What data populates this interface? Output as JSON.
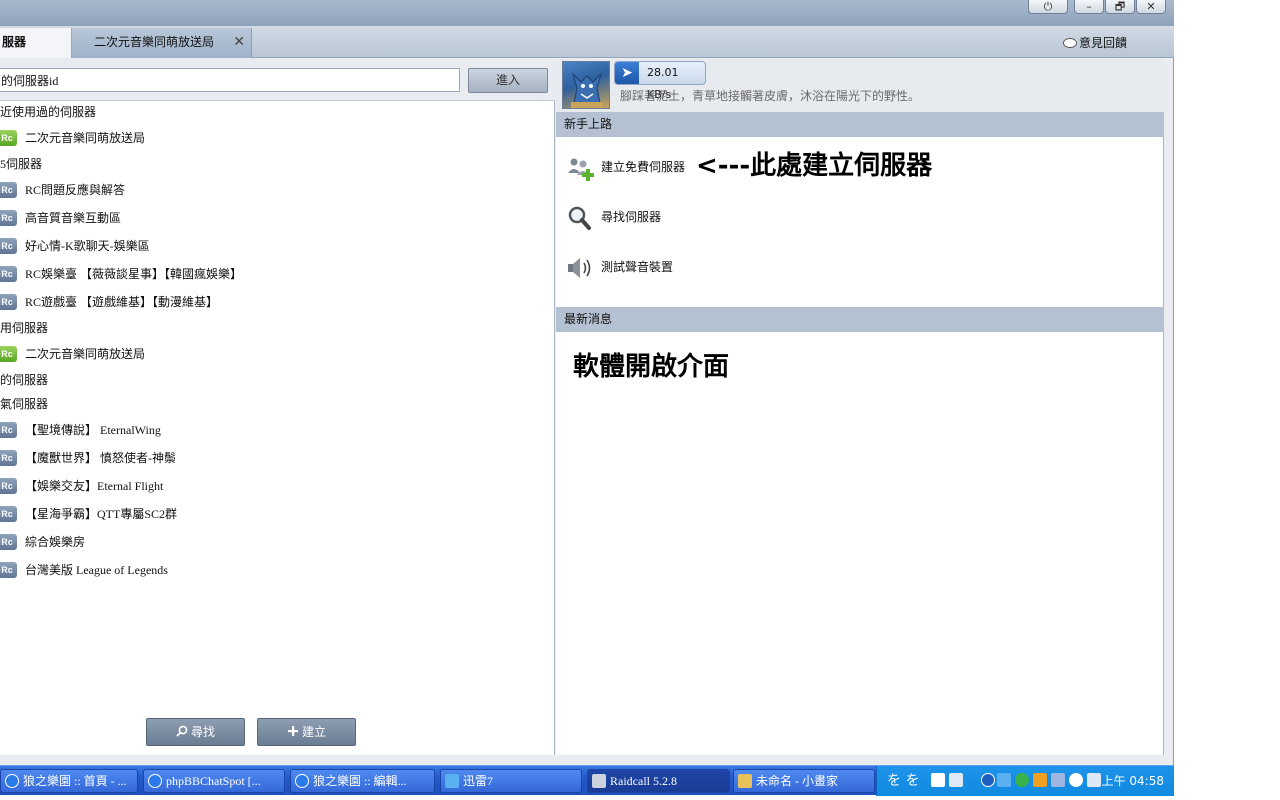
{
  "window": {
    "controls": [
      "⏻",
      "–",
      "🗗",
      "✕"
    ]
  },
  "tabs": [
    {
      "label": "服器",
      "active": true
    },
    {
      "label": "二次元音樂同萌放送局",
      "active": false,
      "close": "✕"
    }
  ],
  "feedback_label": "意見回饋",
  "left_panel": {
    "server_input_value": "的伺服器id",
    "enter_label": "進入",
    "sections": [
      {
        "title": "近使用過的伺服器",
        "items": [
          {
            "name": "二次元音樂同萌放送局",
            "badge": "green"
          }
        ]
      },
      {
        "title": "5伺服器",
        "items": [
          {
            "name": "RC問題反應與解答",
            "badge": "gray"
          },
          {
            "name": "高音質音樂互動區",
            "badge": "gray"
          },
          {
            "name": "好心情-K歌聊天-娛樂區",
            "badge": "gray"
          },
          {
            "name": "RC娛樂臺 【薇薇談星事】【韓國瘋娛樂】",
            "badge": "gray"
          },
          {
            "name": "RC遊戲臺 【遊戲維基】【動漫維基】",
            "badge": "gray"
          }
        ]
      },
      {
        "title": "用伺服器",
        "items": [
          {
            "name": "二次元音樂同萌放送局",
            "badge": "green"
          }
        ]
      },
      {
        "title": "的伺服器",
        "items": []
      },
      {
        "title": "氣伺服器",
        "items": [
          {
            "name": "【聖境傳說】 EternalWing",
            "badge": "gray"
          },
          {
            "name": "【魔獸世界】 憤怒使者-神鬃",
            "badge": "gray"
          },
          {
            "name": "【娛樂交友】Eternal Flight",
            "badge": "gray"
          },
          {
            "name": "【星海爭霸】QTT專屬SC2群",
            "badge": "gray"
          },
          {
            "name": "綜合娛樂房",
            "badge": "gray"
          },
          {
            "name": "台灣美版 League of Legends",
            "badge": "gray"
          }
        ]
      }
    ],
    "badge_text": "Rc",
    "search_label": "尋找",
    "create_label": "建立"
  },
  "right_panel": {
    "speed": "28.01 KB/s",
    "status_text": "腳踩著泥土，青草地接觸著皮膚，沐浴在陽光下的野性。",
    "getting_started_title": "新手上路",
    "actions": [
      {
        "label": "建立免費伺服器",
        "icon": "add-users-icon"
      },
      {
        "label": "尋找伺服器",
        "icon": "magnifier-icon"
      },
      {
        "label": "測試聲音裝置",
        "icon": "speaker-icon"
      }
    ],
    "annotation_arrow": "<---此處建立伺服器",
    "news_title": "最新消息",
    "annotation_interface": "軟體開啟介面"
  },
  "taskbar": {
    "tasks": [
      {
        "label": "狼之樂園 :: 首頁 - ...",
        "icon": "ie-icon"
      },
      {
        "label": "phpBBChatSpot [...",
        "icon": "ie-icon"
      },
      {
        "label": "狼之樂園 :: 編輯...",
        "icon": "ie-icon"
      },
      {
        "label": "迅雷7",
        "icon": "thunder-icon"
      },
      {
        "label": "Raidcall 5.2.8",
        "icon": "raidcall-icon"
      },
      {
        "label": "未命名 - 小畫家",
        "icon": "paint-icon"
      }
    ],
    "tray_glyphs": "を を",
    "clock": "上午 04:58"
  },
  "colors": {
    "taskbar": "#2459c9",
    "section_header": "#b4c1d2",
    "badge_green": "#58a524",
    "badge_gray": "#5f7694"
  }
}
